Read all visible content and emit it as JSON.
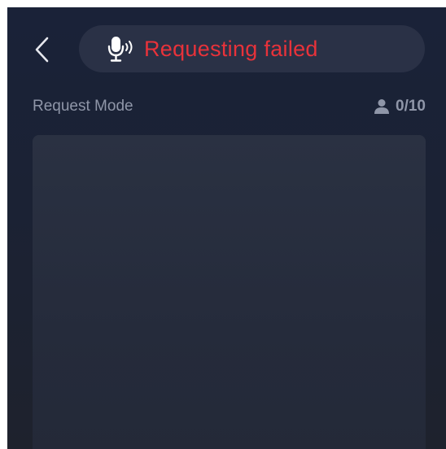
{
  "header": {
    "back_icon": "chevron-left-icon",
    "status_icon": "microphone-speaking-icon",
    "status_text": "Requesting failed",
    "status_color": "#e8323a"
  },
  "request": {
    "mode_label": "Request Mode",
    "count_icon": "person-icon",
    "count_text": "0/10"
  },
  "colors": {
    "background": "#1b2234",
    "pill": "#2a3146",
    "panel": "#282e3f",
    "muted_text": "#8f96a8"
  }
}
